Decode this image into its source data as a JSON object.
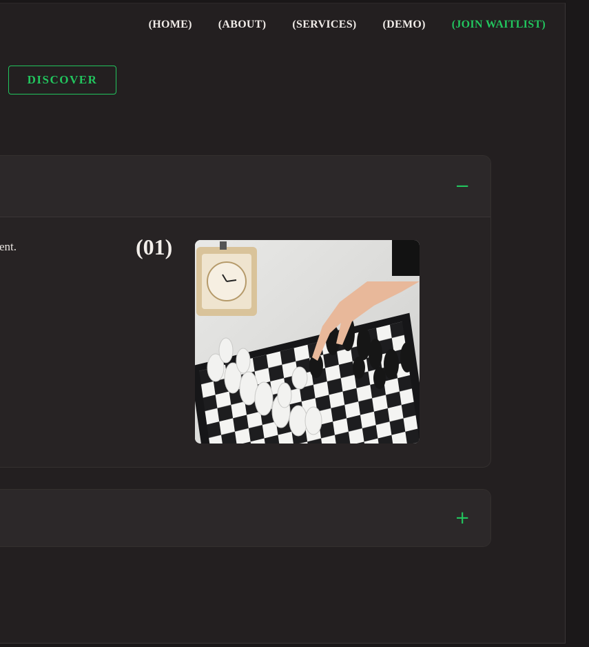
{
  "nav": {
    "items": [
      {
        "label": "(HOME)"
      },
      {
        "label": "(ABOUT)"
      },
      {
        "label": "(SERVICES)"
      },
      {
        "label": "(DEMO)"
      },
      {
        "label": "(JOIN WAITLIST)"
      }
    ]
  },
  "hero": {
    "discover_label": "DISCOVER"
  },
  "accordion": {
    "item1": {
      "toggle": "−",
      "description_tail": "ent.",
      "step_number": "(01)"
    },
    "item2": {
      "toggle": "+"
    }
  },
  "colors": {
    "accent": "#22c55e",
    "background": "#231f20",
    "panel": "#272324"
  }
}
